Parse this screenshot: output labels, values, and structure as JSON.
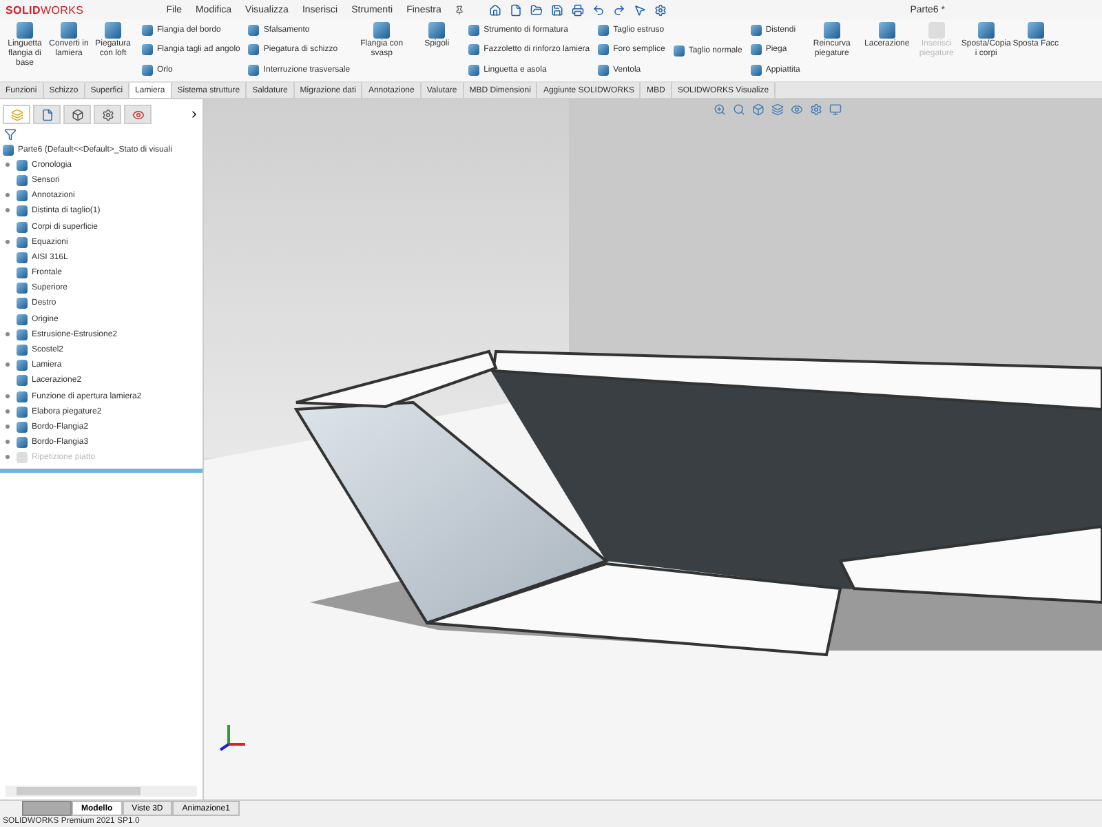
{
  "app": {
    "logo": "**SOLID**WORKS",
    "menu": [
      "File",
      "Modifica",
      "Visualizza",
      "Inserisci",
      "Strumenti",
      "Finestra"
    ],
    "title": "Parte6 *"
  },
  "ribbon": {
    "groups": [
      {
        "kind": "large",
        "items": [
          {
            "label": "Linguetta flangia di base",
            "disabled": false
          },
          {
            "label": "Converti in lamiera",
            "disabled": false
          },
          {
            "label": "Piegatura con loft",
            "disabled": false
          }
        ]
      },
      {
        "kind": "list",
        "items": [
          {
            "label": "Flangia del bordo",
            "disabled": false
          },
          {
            "label": "Flangia tagli ad angolo",
            "disabled": false
          },
          {
            "label": "Orlo",
            "disabled": false
          }
        ]
      },
      {
        "kind": "list",
        "items": [
          {
            "label": "Sfalsamento",
            "disabled": false
          },
          {
            "label": "Piegatura di schizzo",
            "disabled": false
          },
          {
            "label": "Interruzione trasversale",
            "disabled": false
          }
        ]
      },
      {
        "kind": "large",
        "items": [
          {
            "label": "Flangia con svasp",
            "disabled": false
          }
        ]
      },
      {
        "kind": "large",
        "items": [
          {
            "label": "Spigoli",
            "disabled": false
          }
        ]
      },
      {
        "kind": "list",
        "items": [
          {
            "label": "Strumento di formatura",
            "disabled": false
          },
          {
            "label": "Fazzoletto di rinforzo lamiera",
            "disabled": false
          },
          {
            "label": "Linguetta e asola",
            "disabled": false
          }
        ]
      },
      {
        "kind": "list",
        "items": [
          {
            "label": "Taglio estruso",
            "disabled": false
          },
          {
            "label": "Foro semplice",
            "disabled": false
          },
          {
            "label": "Ventola",
            "disabled": false
          }
        ]
      },
      {
        "kind": "list",
        "items": [
          {
            "label": "Taglio normale",
            "disabled": false
          }
        ]
      },
      {
        "kind": "list",
        "items": [
          {
            "label": "Distendi",
            "disabled": false
          },
          {
            "label": "Piega",
            "disabled": false
          },
          {
            "label": "Appiattita",
            "disabled": false
          }
        ]
      },
      {
        "kind": "large",
        "items": [
          {
            "label": "Reincurva piegature",
            "disabled": false
          }
        ]
      },
      {
        "kind": "large",
        "items": [
          {
            "label": "Lacerazione",
            "disabled": false
          },
          {
            "label": "Inserisci piegature",
            "disabled": true
          },
          {
            "label": "Sposta/Copia i corpi",
            "disabled": false
          },
          {
            "label": "Sposta Facc",
            "disabled": false
          }
        ]
      }
    ]
  },
  "tabs": [
    {
      "label": "Funzioni",
      "selected": false
    },
    {
      "label": "Schizzo",
      "selected": false
    },
    {
      "label": "Superfici",
      "selected": false
    },
    {
      "label": "Lamiera",
      "selected": true
    },
    {
      "label": "Sistema strutture",
      "selected": false
    },
    {
      "label": "Saldature",
      "selected": false
    },
    {
      "label": "Migrazione dati",
      "selected": false
    },
    {
      "label": "Annotazione",
      "selected": false
    },
    {
      "label": "Valutare",
      "selected": false
    },
    {
      "label": "MBD Dimensioni",
      "selected": false
    },
    {
      "label": "Aggiunte SOLIDWORKS",
      "selected": false
    },
    {
      "label": "MBD",
      "selected": false
    },
    {
      "label": "SOLIDWORKS Visualize",
      "selected": false
    }
  ],
  "tree": {
    "root": "Parte6  (Default<<Default>_Stato di visuali",
    "items": [
      {
        "label": "Cronologia",
        "expandable": true,
        "disabled": false
      },
      {
        "label": "Sensori",
        "expandable": false,
        "disabled": false
      },
      {
        "label": "Annotazioni",
        "expandable": true,
        "disabled": false
      },
      {
        "label": "Distinta di taglio(1)",
        "expandable": true,
        "disabled": false
      },
      {
        "label": "Corpi di superficie",
        "expandable": false,
        "disabled": false
      },
      {
        "label": "Equazioni",
        "expandable": true,
        "disabled": false
      },
      {
        "label": "AISI 316L",
        "expandable": false,
        "disabled": false
      },
      {
        "label": "Frontale",
        "expandable": false,
        "disabled": false
      },
      {
        "label": "Superiore",
        "expandable": false,
        "disabled": false
      },
      {
        "label": "Destro",
        "expandable": false,
        "disabled": false
      },
      {
        "label": "Origine",
        "expandable": false,
        "disabled": false
      },
      {
        "label": "Estrusione-Estrusione2",
        "expandable": true,
        "disabled": false
      },
      {
        "label": "Scostel2",
        "expandable": false,
        "disabled": false
      },
      {
        "label": "Lamiera",
        "expandable": true,
        "disabled": false
      },
      {
        "label": "Lacerazione2",
        "expandable": false,
        "disabled": false
      },
      {
        "label": "Funzione di apertura lamiera2",
        "expandable": true,
        "disabled": false
      },
      {
        "label": "Elabora piegature2",
        "expandable": true,
        "disabled": false
      },
      {
        "label": "Bordo-Flangia2",
        "expandable": true,
        "disabled": false
      },
      {
        "label": "Bordo-Flangia3",
        "expandable": true,
        "disabled": false
      },
      {
        "label": "Ripetizione piatto",
        "expandable": true,
        "disabled": true
      }
    ]
  },
  "bottom_tabs": [
    {
      "label": "Modello",
      "selected": true
    },
    {
      "label": "Viste 3D",
      "selected": false
    },
    {
      "label": "Animazione1",
      "selected": false
    }
  ],
  "status_bar": "SOLIDWORKS Premium 2021 SP1.0"
}
